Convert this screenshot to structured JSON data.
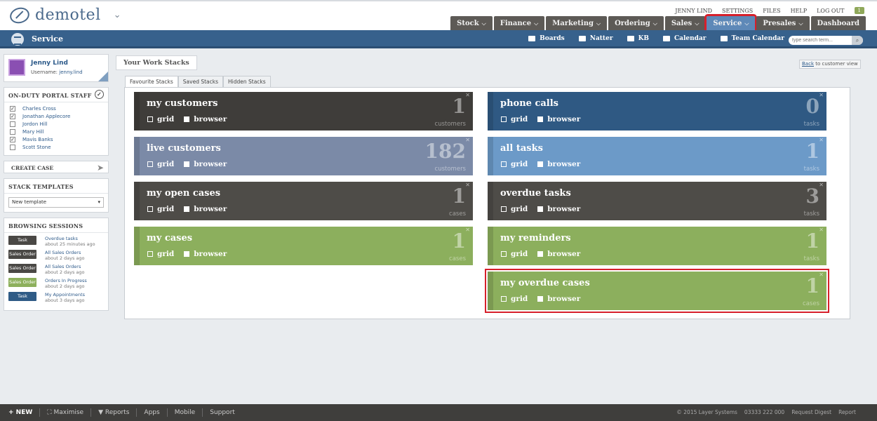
{
  "brand": {
    "name": "demotel"
  },
  "toplinks": [
    "JENNY LIND",
    "SETTINGS",
    "FILES",
    "HELP",
    "LOG OUT"
  ],
  "toplinks_badge": "1",
  "mainnav": [
    {
      "label": "Stock"
    },
    {
      "label": "Finance"
    },
    {
      "label": "Marketing"
    },
    {
      "label": "Ordering"
    },
    {
      "label": "Sales"
    },
    {
      "label": "Service"
    },
    {
      "label": "Presales"
    },
    {
      "label": "Dashboard"
    }
  ],
  "section": {
    "title": "Service"
  },
  "subnav": [
    "Boards",
    "Natter",
    "KB",
    "Calendar",
    "Team Calendar"
  ],
  "search": {
    "placeholder": "type search term..."
  },
  "profile": {
    "name": "Jenny Lind",
    "username_label": "Username:",
    "username": "jenny.lind"
  },
  "staff": {
    "title": "ON-DUTY PORTAL STAFF",
    "members": [
      {
        "name": "Charles Cross",
        "checked": true
      },
      {
        "name": "Jonathan Applecore",
        "checked": true
      },
      {
        "name": "Jordon Hill",
        "checked": false
      },
      {
        "name": "Mary Hill",
        "checked": false
      },
      {
        "name": "Mavis Banks",
        "checked": true
      },
      {
        "name": "Scott Stone",
        "checked": false
      }
    ]
  },
  "create_case": {
    "label": "CREATE CASE"
  },
  "templates": {
    "title": "STACK TEMPLATES",
    "selected": "New template"
  },
  "sessions": {
    "title": "BROWSING SESSIONS",
    "items": [
      {
        "tag": "Task",
        "color": "#4a4845",
        "title": "Overdue tasks",
        "time": "about 25 minutes ago"
      },
      {
        "tag": "Sales Order",
        "color": "#4a4845",
        "title": "All Sales Orders",
        "time": "about 2 days ago"
      },
      {
        "tag": "Sales Order",
        "color": "#4a4845",
        "title": "All Sales Orders",
        "time": "about 2 days ago"
      },
      {
        "tag": "Sales Order",
        "color": "#8db05c",
        "title": "Orders In Progress",
        "time": "about 2 days ago"
      },
      {
        "tag": "Task",
        "color": "#2f5b86",
        "title": "My Appointments",
        "time": "about 3 days ago"
      }
    ]
  },
  "work": {
    "title": "Your Work Stacks",
    "back_prefix": "Back",
    "back_suffix": " to customer view",
    "tabs": [
      "Favourite Stacks",
      "Saved Stacks",
      "Hidden Stacks"
    ]
  },
  "options": {
    "grid": "grid",
    "browser": "browser"
  },
  "stacks": [
    {
      "title": "my customers",
      "count": "1",
      "unit": "customers",
      "color": "#3f3d3a"
    },
    {
      "title": "phone calls",
      "count": "0",
      "unit": "tasks",
      "color": "#2f5983"
    },
    {
      "title": "live customers",
      "count": "182",
      "unit": "customers",
      "color": "#7b8aa7"
    },
    {
      "title": "all tasks",
      "count": "1",
      "unit": "tasks",
      "color": "#6c9ac8"
    },
    {
      "title": "my open cases",
      "count": "1",
      "unit": "cases",
      "color": "#4e4c48"
    },
    {
      "title": "overdue tasks",
      "count": "3",
      "unit": "tasks",
      "color": "#4e4c48"
    },
    {
      "title": "my cases",
      "count": "1",
      "unit": "cases",
      "color": "#8caf5d"
    },
    {
      "title": "my reminders",
      "count": "1",
      "unit": "tasks",
      "color": "#8caf5d"
    },
    {
      "title": "my overdue cases",
      "count": "1",
      "unit": "cases",
      "color": "#8caf5d"
    }
  ],
  "footer": {
    "new": "+ NEW",
    "links": [
      "Maximise",
      "Reports",
      "Apps",
      "Mobile",
      "Support"
    ],
    "copyright": "© 2015 Layer Systems",
    "phone": "03333 222 000",
    "digest": "Request Digest",
    "report": "Report"
  }
}
